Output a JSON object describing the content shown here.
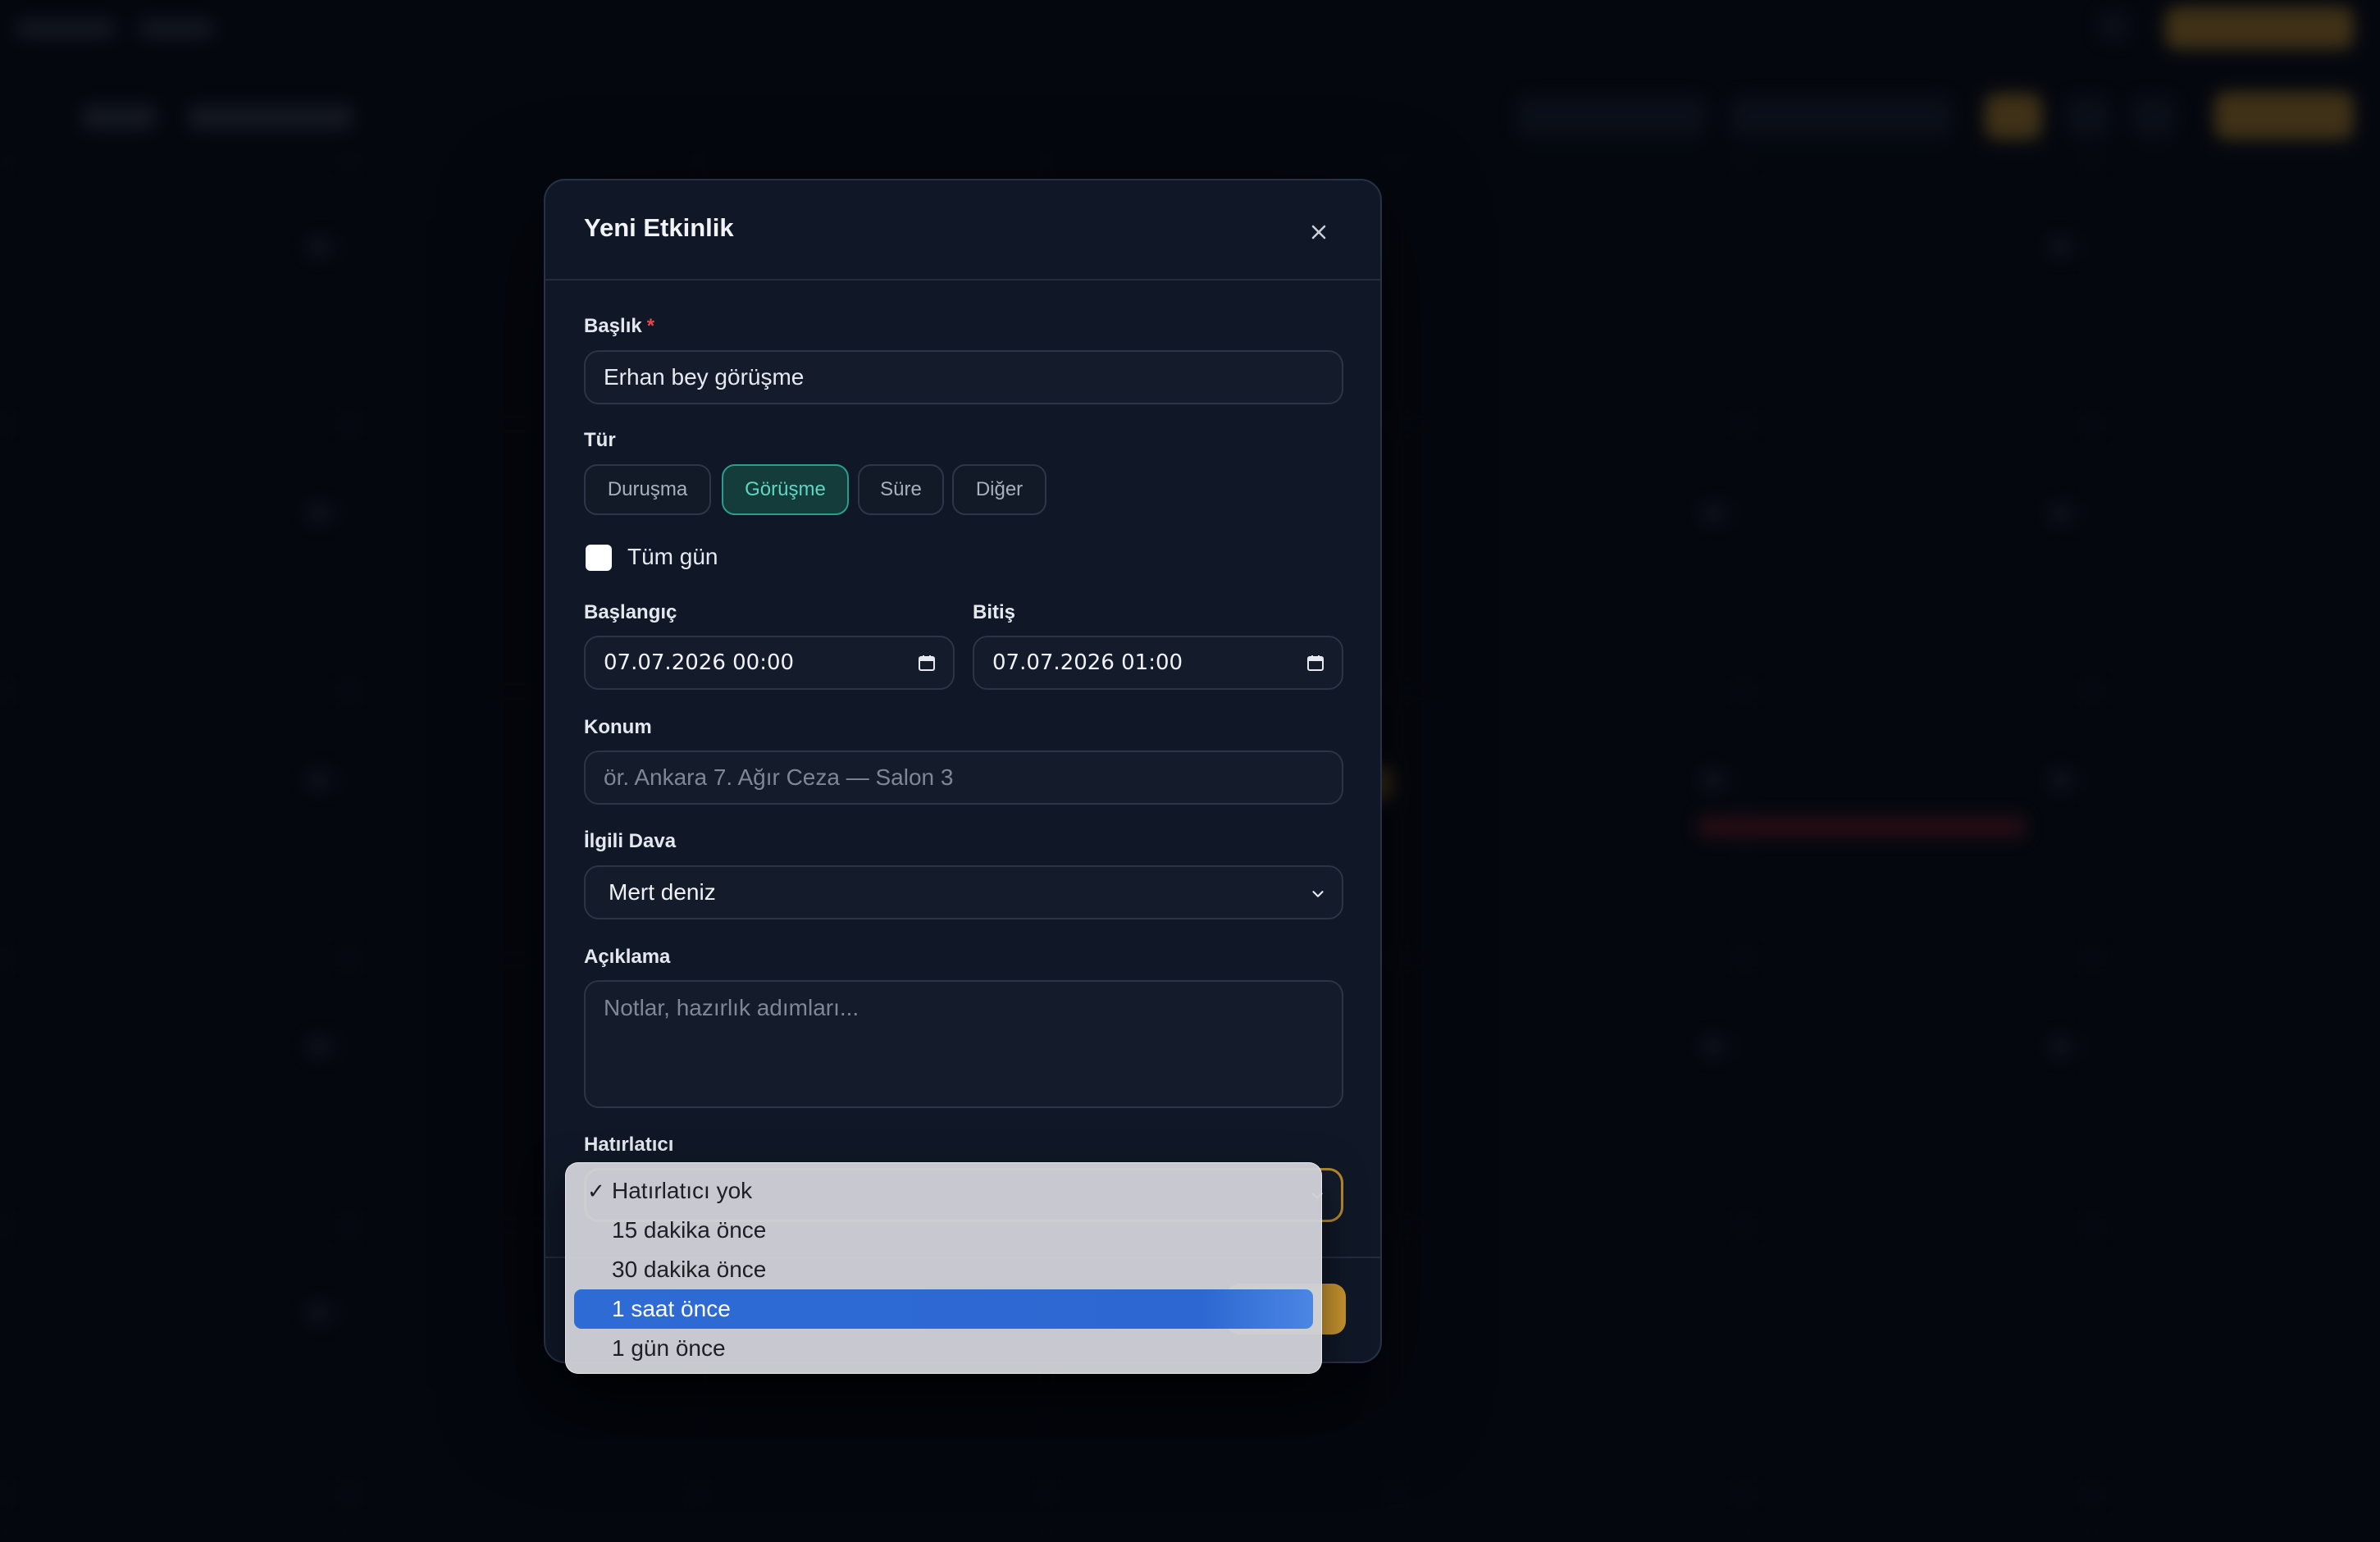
{
  "modal": {
    "title": "Yeni Etkinlik",
    "close_icon": "close-icon"
  },
  "form": {
    "title_label": "Başlık",
    "required_mark": "*",
    "title_value": "Erhan bey görüşme",
    "type_label": "Tür",
    "types": [
      {
        "label": "Duruşma",
        "selected": false
      },
      {
        "label": "Görüşme",
        "selected": true
      },
      {
        "label": "Süre",
        "selected": false
      },
      {
        "label": "Diğer",
        "selected": false
      }
    ],
    "all_day_label": "Tüm gün",
    "all_day_checked": false,
    "start_label": "Başlangıç",
    "start_value": "07.07.2026 00:00",
    "end_label": "Bitiş",
    "end_value": "07.07.2026 01:00",
    "location_label": "Konum",
    "location_placeholder": "ör. Ankara 7. Ağır Ceza — Salon 3",
    "case_label": "İlgili Dava",
    "case_value": "Mert deniz",
    "description_label": "Açıklama",
    "description_placeholder": "Notlar, hazırlık adımları...",
    "reminder_label": "Hatırlatıcı"
  },
  "reminder_dropdown": {
    "options": [
      {
        "label": "Hatırlatıcı yok",
        "checked": true,
        "highlighted": false
      },
      {
        "label": "15 dakika önce",
        "checked": false,
        "highlighted": false
      },
      {
        "label": "30 dakika önce",
        "checked": false,
        "highlighted": false
      },
      {
        "label": "1 saat önce",
        "checked": false,
        "highlighted": true
      },
      {
        "label": "1 gün önce",
        "checked": false,
        "highlighted": false
      }
    ],
    "check_glyph": "✓"
  },
  "colors": {
    "accent_gold": "#c9962f",
    "selected_type_teal": "#2d9c8c",
    "highlight_blue": "#2f6bd4",
    "required_red": "#e5484d"
  }
}
